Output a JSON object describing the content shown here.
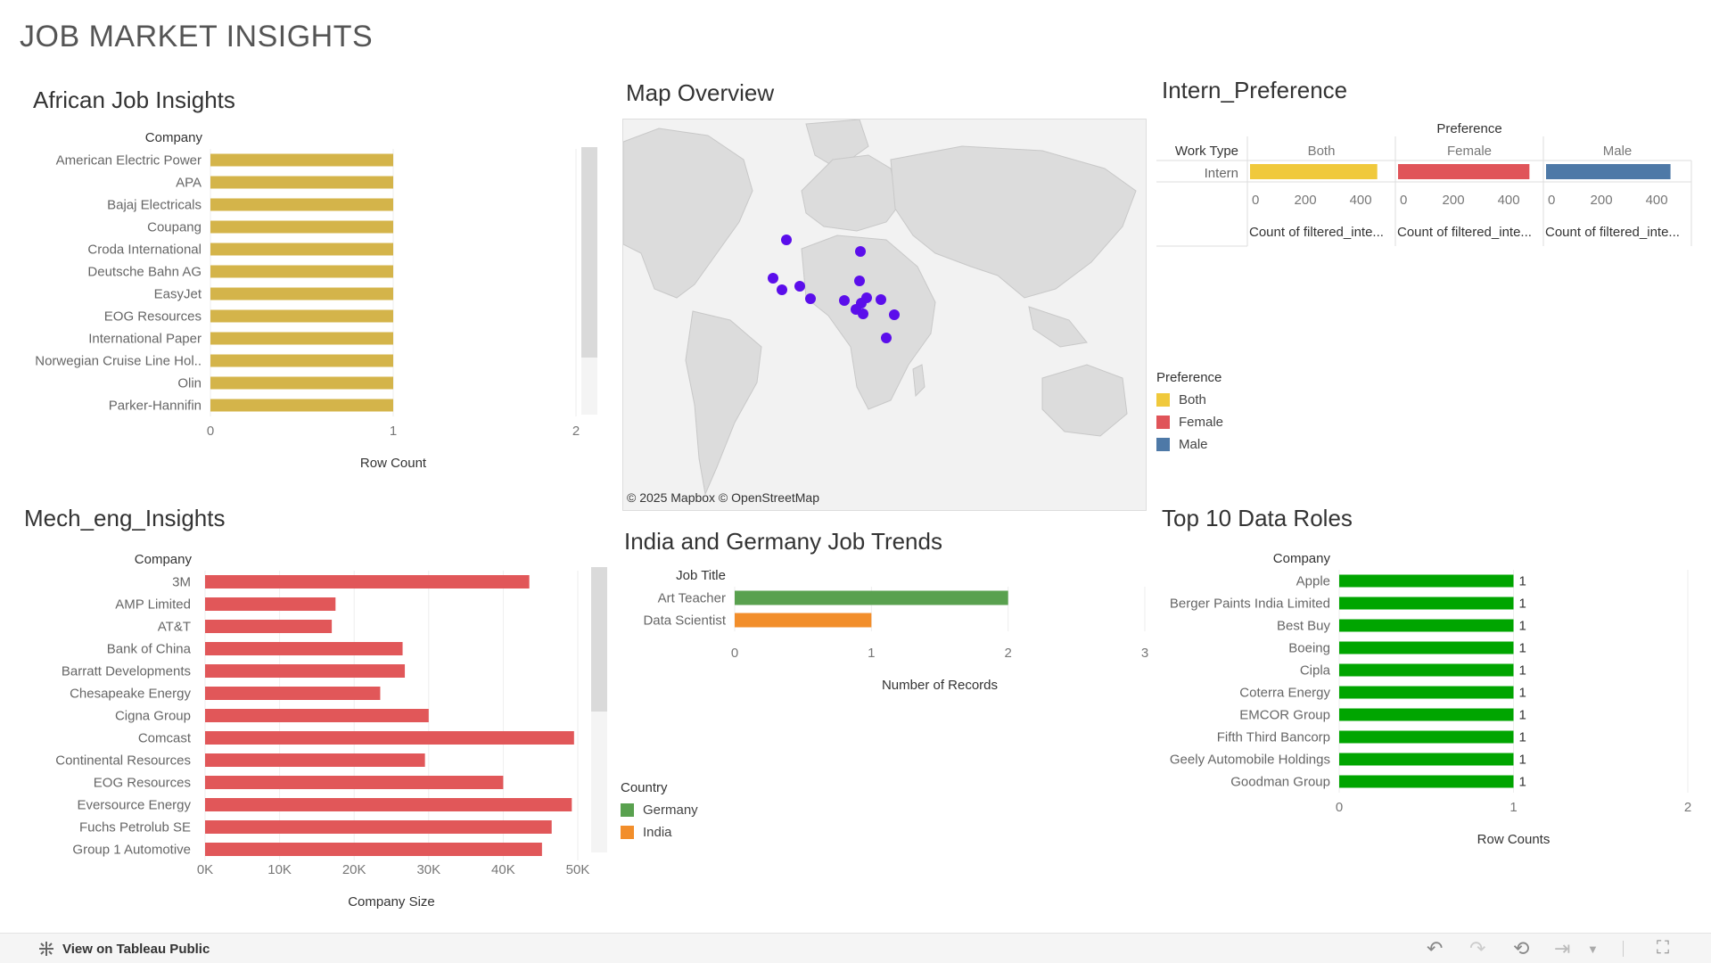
{
  "dashboard_title": "JOB MARKET INSIGHTS",
  "african": {
    "title": "African Job Insights",
    "chart_data": {
      "type": "bar",
      "orientation": "horizontal",
      "ylabel": "Company",
      "xlabel": "Row Count",
      "xlim": [
        0,
        2
      ],
      "ticks": [
        "0",
        "1",
        "2"
      ],
      "categories": [
        "American Electric Power",
        "APA",
        "Bajaj Electricals",
        "Coupang",
        "Croda International",
        "Deutsche Bahn AG",
        "EasyJet",
        "EOG Resources",
        "International Paper",
        "Norwegian Cruise Line Hol..",
        "Olin",
        "Parker-Hannifin"
      ],
      "values": [
        1,
        1,
        1,
        1,
        1,
        1,
        1,
        1,
        1,
        1,
        1,
        1
      ],
      "color": "#D4B44A"
    }
  },
  "map": {
    "title": "Map Overview",
    "attribution": "© 2025 Mapbox  © OpenStreetMap",
    "point_color": "#5B0EEB"
  },
  "intern": {
    "title": "Intern_Preference",
    "chart_data": {
      "type": "bar",
      "column_header": "Preference",
      "row_header": "Work Type",
      "row": "Intern",
      "series": [
        {
          "name": "Both",
          "value": 460,
          "color": "#F0C93C"
        },
        {
          "name": "Female",
          "value": 475,
          "color": "#E05459"
        },
        {
          "name": "Male",
          "value": 450,
          "color": "#4E79A7"
        }
      ],
      "ticks": [
        "0",
        "200",
        "400"
      ],
      "xlim": [
        0,
        490
      ],
      "axis_title": "Count of filtered_inte..."
    },
    "legend": {
      "title": "Preference",
      "items": [
        {
          "label": "Both",
          "color": "#F0C93C"
        },
        {
          "label": "Female",
          "color": "#E05459"
        },
        {
          "label": "Male",
          "color": "#4E79A7"
        }
      ]
    }
  },
  "mech": {
    "title": "Mech_eng_Insights",
    "chart_data": {
      "type": "bar",
      "orientation": "horizontal",
      "ylabel": "Company",
      "xlabel": "Company Size",
      "xlim": [
        0,
        50000
      ],
      "ticks": [
        "0K",
        "10K",
        "20K",
        "30K",
        "40K",
        "50K"
      ],
      "categories": [
        "3M",
        "AMP Limited",
        "AT&T",
        "Bank of China",
        "Barratt Developments",
        "Chesapeake Energy",
        "Cigna Group",
        "Comcast",
        "Continental Resources",
        "EOG Resources",
        "Eversource Energy",
        "Fuchs Petrolub SE",
        "Group 1 Automotive"
      ],
      "values": [
        43500,
        17500,
        17000,
        26500,
        26800,
        23500,
        30000,
        49500,
        29500,
        40000,
        49200,
        46500,
        45200
      ],
      "color": "#E15759"
    }
  },
  "india_germany": {
    "title": "India and Germany Job Trends",
    "chart_data": {
      "type": "bar",
      "orientation": "horizontal",
      "ylabel": "Job Title",
      "xlabel": "Number of Records",
      "xlim": [
        0,
        3
      ],
      "ticks": [
        "0",
        "1",
        "2",
        "3"
      ],
      "categories": [
        "Art Teacher",
        "Data Scientist"
      ],
      "values": [
        2,
        1
      ],
      "colors": [
        "#59A14F",
        "#F28E2B"
      ]
    },
    "legend": {
      "title": "Country",
      "items": [
        {
          "label": "Germany",
          "color": "#59A14F"
        },
        {
          "label": "India",
          "color": "#F28E2B"
        }
      ]
    }
  },
  "top10": {
    "title": "Top 10 Data Roles",
    "chart_data": {
      "type": "bar",
      "orientation": "horizontal",
      "ylabel": "Company",
      "xlabel": "Row Counts",
      "xlim": [
        0,
        2
      ],
      "ticks": [
        "0",
        "1",
        "2"
      ],
      "categories": [
        "Apple",
        "Berger Paints India Limited",
        "Best Buy",
        "Boeing",
        "Cipla",
        "Coterra Energy",
        "EMCOR Group",
        "Fifth Third Bancorp",
        "Geely Automobile Holdings",
        "Goodman Group"
      ],
      "values": [
        1,
        1,
        1,
        1,
        1,
        1,
        1,
        1,
        1,
        1
      ],
      "data_labels": [
        "1",
        "1",
        "1",
        "1",
        "1",
        "1",
        "1",
        "1",
        "1",
        "1"
      ],
      "color": "#00A500"
    }
  },
  "footer": {
    "view_label": "View on Tableau Public"
  }
}
